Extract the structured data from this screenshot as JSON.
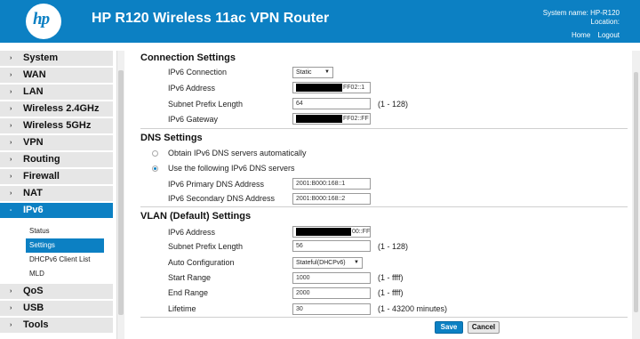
{
  "header": {
    "logo_text": "hp",
    "title": "HP R120 Wireless 11ac VPN Router",
    "system_name_label": "System name: HP-R120",
    "location_label": "Location:",
    "links": [
      "Home",
      "Logout"
    ]
  },
  "sidebar": {
    "items": [
      {
        "label": "System"
      },
      {
        "label": "WAN"
      },
      {
        "label": "LAN"
      },
      {
        "label": "Wireless 2.4GHz"
      },
      {
        "label": "Wireless 5GHz"
      },
      {
        "label": "VPN"
      },
      {
        "label": "Routing"
      },
      {
        "label": "Firewall"
      },
      {
        "label": "NAT"
      },
      {
        "label": "IPv6"
      }
    ],
    "subitems": [
      "Status",
      "Settings",
      "DHCPv6 Client List",
      "MLD"
    ],
    "items_after": [
      {
        "label": "QoS"
      },
      {
        "label": "USB"
      },
      {
        "label": "Tools"
      }
    ],
    "collapsed_arrow": "›",
    "expanded_arrow": "-"
  },
  "connection": {
    "title": "Connection Settings",
    "ipv6_connection_label": "IPv6 Connection",
    "ipv6_connection_value": "Static",
    "ipv6_address_label": "IPv6 Address",
    "ipv6_address_value": "FF02::1",
    "prefix_label": "Subnet Prefix Length",
    "prefix_value": "64",
    "prefix_hint": "(1 - 128)",
    "gateway_label": "IPv6 Gateway",
    "gateway_value": "FF02::FF"
  },
  "dns": {
    "title": "DNS Settings",
    "auto_label": "Obtain IPv6 DNS servers automatically",
    "manual_label": "Use the following IPv6 DNS servers",
    "primary_label": "IPv6 Primary DNS Address",
    "primary_value": "2001:B000:168::1",
    "secondary_label": "IPv6 Secondary DNS Address",
    "secondary_value": "2001:B000:168::2"
  },
  "vlan": {
    "title": "VLAN (Default) Settings",
    "address_label": "IPv6 Address",
    "address_value": "00::FF",
    "prefix_label": "Subnet Prefix Length",
    "prefix_value": "56",
    "prefix_hint": "(1 - 128)",
    "autoconf_label": "Auto Configuration",
    "autoconf_value": "Stateful(DHCPv6)",
    "start_label": "Start Range",
    "start_value": "1000",
    "start_hint": "(1 - ffff)",
    "end_label": "End Range",
    "end_value": "2000",
    "end_hint": "(1 - ffff)",
    "lifetime_label": "Lifetime",
    "lifetime_value": "30",
    "lifetime_hint": "(1 - 43200 minutes)"
  },
  "buttons": {
    "save": "Save",
    "cancel": "Cancel"
  },
  "colors": {
    "accent": "#0c80c3",
    "nav_bg": "#e6e6e6"
  }
}
